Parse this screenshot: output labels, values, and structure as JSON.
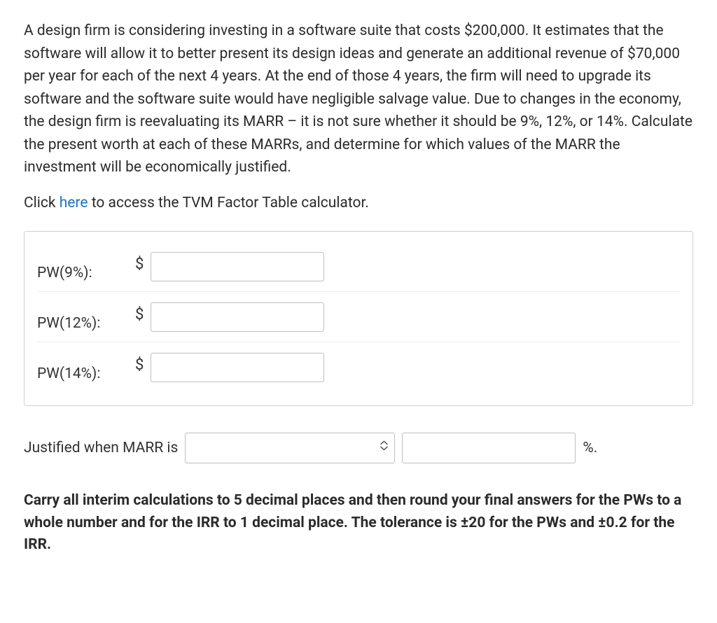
{
  "problem": {
    "text": "A design firm is considering investing in a software suite that costs $200,000. It estimates that the software will allow it to better present its design ideas and generate an additional revenue of $70,000 per year for each of the next 4 years. At the end of those 4 years, the firm will need to upgrade its software and the software suite would have negligible salvage value. Due to changes in the economy, the design firm is reevaluating its MARR – it is not sure whether it should be 9%, 12%, or 14%. Calculate the present worth at each of these MARRs, and determine for which values of the MARR the investment will be economically justified."
  },
  "tvm": {
    "prefix": "Click ",
    "link": "here",
    "suffix": " to access the TVM Factor Table calculator."
  },
  "inputs": {
    "pw9": {
      "label": "PW(9%):",
      "currency": "$",
      "value": ""
    },
    "pw12": {
      "label": "PW(12%):",
      "currency": "$",
      "value": ""
    },
    "pw14": {
      "label": "PW(14%):",
      "currency": "$",
      "value": ""
    }
  },
  "justified": {
    "prefix": "Justified when MARR is",
    "select_value": "",
    "marr_value": "",
    "suffix": "%."
  },
  "instructions": "Carry all interim calculations to 5 decimal places and then round your final answers for the PWs to a whole number and for the IRR to 1 decimal place. The tolerance is ±20 for the PWs and ±0.2 for the IRR."
}
